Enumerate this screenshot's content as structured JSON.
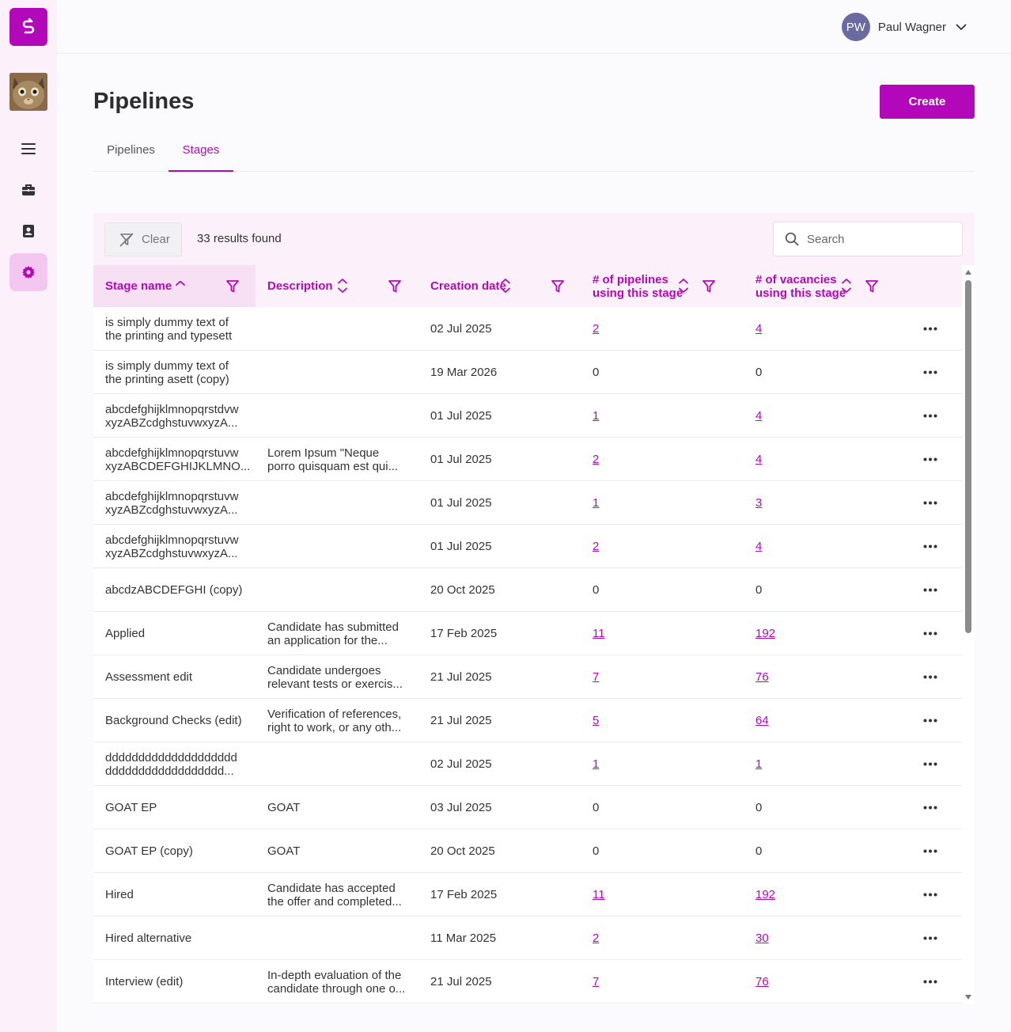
{
  "user": {
    "initials": "PW",
    "name": "Paul Wagner"
  },
  "page": {
    "title": "Pipelines",
    "create_label": "Create"
  },
  "tabs": [
    {
      "label": "Pipelines"
    },
    {
      "label": "Stages"
    }
  ],
  "toolbar": {
    "clear_label": "Clear",
    "results_text": "33 results found",
    "search_placeholder": "Search"
  },
  "columns": [
    {
      "label": "Stage name"
    },
    {
      "label": "Description"
    },
    {
      "label": "Creation date"
    },
    {
      "label": "# of pipelines\nusing this stage"
    },
    {
      "label": "# of vacancies\nusing this stage"
    }
  ],
  "rows": [
    {
      "name": "is simply dummy text of\nthe printing and typesett",
      "description": "",
      "date": "02 Jul 2025",
      "pipelines": "2",
      "vacancies": "4"
    },
    {
      "name": "is simply dummy text of\nthe printing asett (copy)",
      "description": "",
      "date": "19 Mar 2026",
      "pipelines": "0",
      "vacancies": "0"
    },
    {
      "name": "abcdefghijklmnopqrstdvw\nxyzABZcdghstuvwxyzA...",
      "description": "",
      "date": "01 Jul 2025",
      "pipelines": "1",
      "vacancies": "4"
    },
    {
      "name": "abcdefghijklmnopqrstuvw\nxyzABCDEFGHIJKLMNO...",
      "description": "Lorem Ipsum \"Neque\nporro quisquam est qui...",
      "date": "01 Jul 2025",
      "pipelines": "2",
      "vacancies": "4"
    },
    {
      "name": "abcdefghijklmnopqrstuvw\nxyzABZcdghstuvwxyzA...",
      "description": "",
      "date": "01 Jul 2025",
      "pipelines": "1",
      "vacancies": "3"
    },
    {
      "name": "abcdefghijklmnopqrstuvw\nxyzABZcdghstuvwxyzA...",
      "description": "",
      "date": "01 Jul 2025",
      "pipelines": "2",
      "vacancies": "4"
    },
    {
      "name": "abcdzABCDEFGHI (copy)",
      "description": "",
      "date": "20 Oct 2025",
      "pipelines": "0",
      "vacancies": "0"
    },
    {
      "name": "Applied",
      "description": "Candidate has submitted\nan application for the...",
      "date": "17 Feb 2025",
      "pipelines": "11",
      "vacancies": "192"
    },
    {
      "name": "Assessment edit",
      "description": "Candidate undergoes\nrelevant tests or exercis...",
      "date": "21 Jul 2025",
      "pipelines": "7",
      "vacancies": "76"
    },
    {
      "name": "Background Checks (edit)",
      "description": "Verification of references,\nright to work, or any oth...",
      "date": "21 Jul 2025",
      "pipelines": "5",
      "vacancies": "64"
    },
    {
      "name": "dddddddddddddddddddd\ndddddddddddddddddd...",
      "description": "",
      "date": "02 Jul 2025",
      "pipelines": "1",
      "vacancies": "1"
    },
    {
      "name": "GOAT EP",
      "description": "GOAT",
      "date": "03 Jul 2025",
      "pipelines": "0",
      "vacancies": "0"
    },
    {
      "name": "GOAT EP (copy)",
      "description": "GOAT",
      "date": "20 Oct 2025",
      "pipelines": "0",
      "vacancies": "0"
    },
    {
      "name": "Hired",
      "description": "Candidate has accepted\nthe offer and completed...",
      "date": "17 Feb 2025",
      "pipelines": "11",
      "vacancies": "192"
    },
    {
      "name": "Hired alternative",
      "description": "",
      "date": "11 Mar 2025",
      "pipelines": "2",
      "vacancies": "30"
    },
    {
      "name": "Interview (edit)",
      "description": "In-depth evaluation of the\ncandidate through one o...",
      "date": "21 Jul 2025",
      "pipelines": "7",
      "vacancies": "76"
    }
  ],
  "colors": {
    "accent": "#b308ba",
    "accent_soft": "#fcf1fa",
    "sidebar_bg": "#fcf0fa"
  },
  "icons": {
    "sidebar": [
      "logo-icon",
      "cat-avatar",
      "menu-icon",
      "briefcase-icon",
      "contacts-icon",
      "settings-icon"
    ],
    "row_action": "more-dots-icon"
  }
}
